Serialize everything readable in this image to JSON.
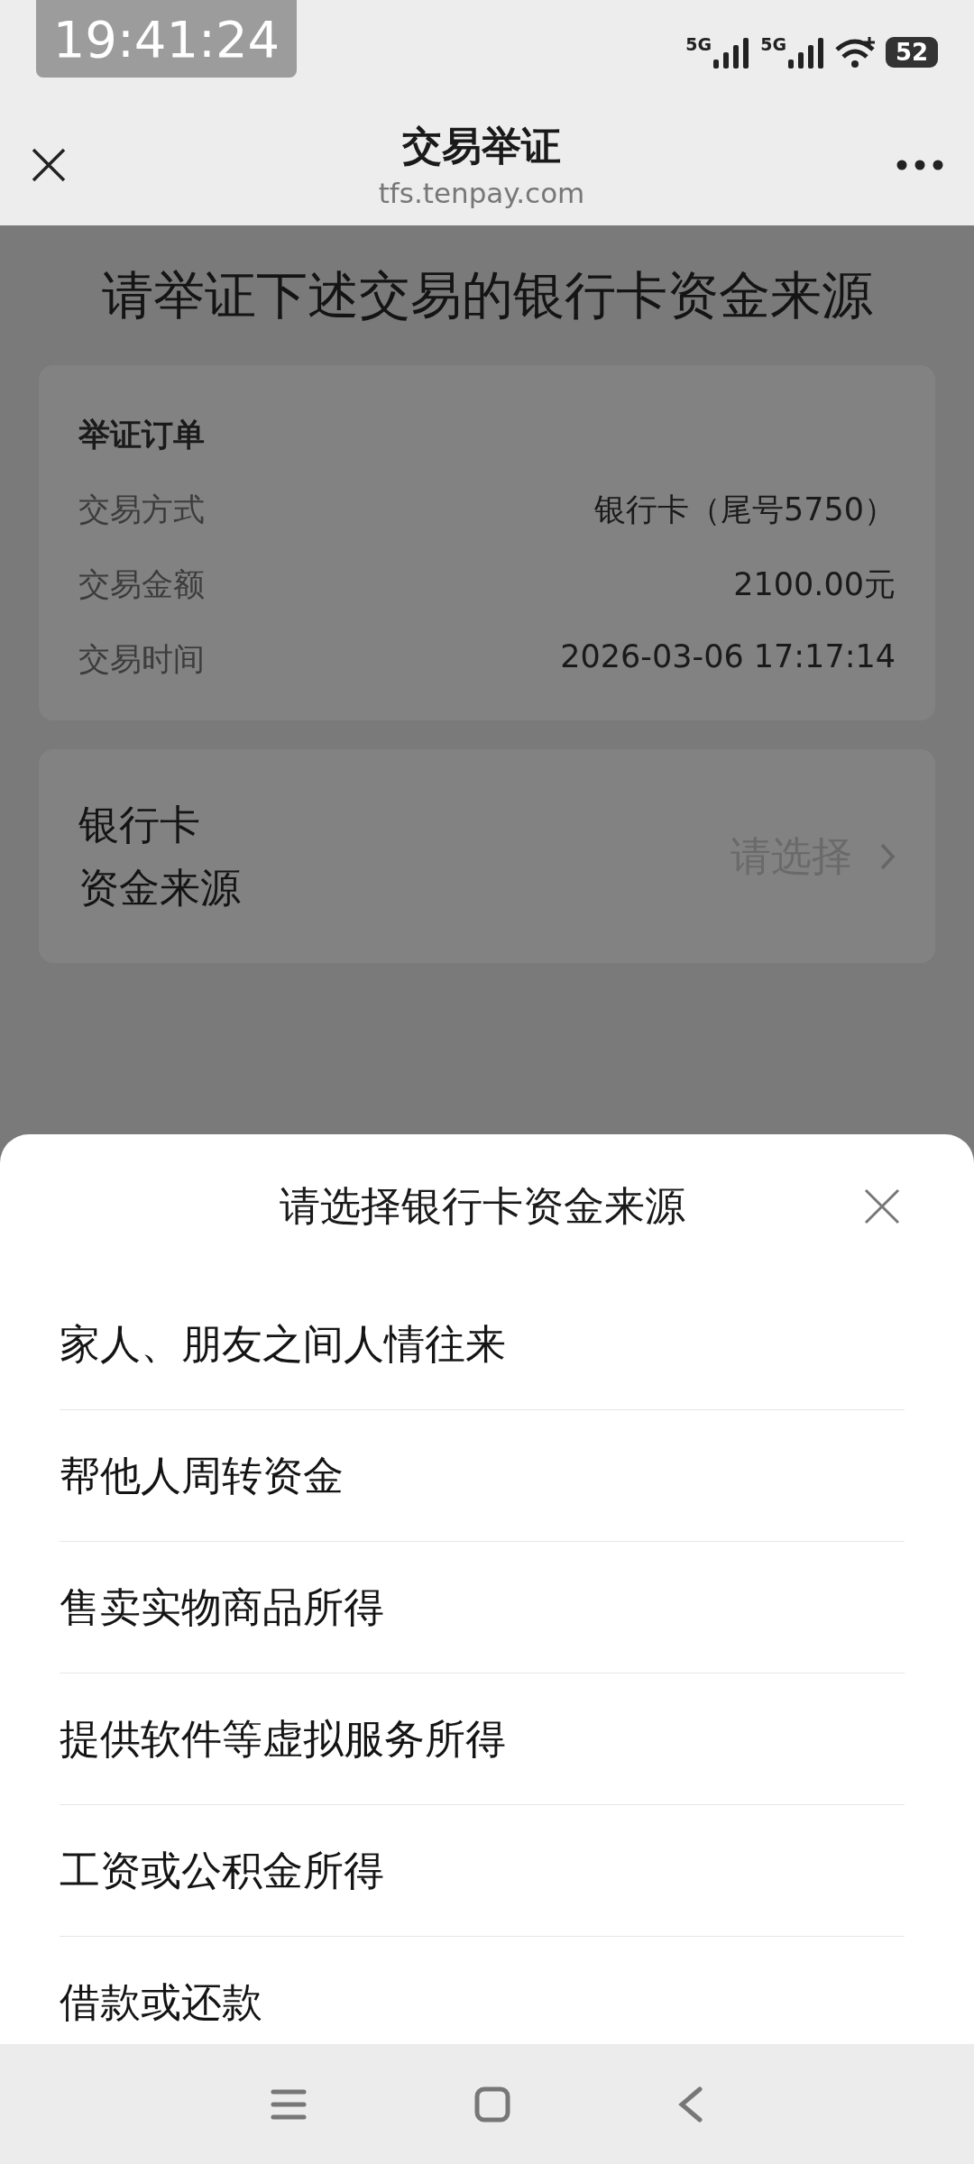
{
  "recorder_overlay": {
    "time": "19:41:24"
  },
  "status_bar": {
    "sim_1": "5G",
    "sim_2": "5G",
    "battery": "52"
  },
  "header": {
    "title": "交易举证",
    "url": "tfs.tenpay.com"
  },
  "page": {
    "heading": "请举证下述交易的银行卡资金来源",
    "order_card": {
      "title": "举证订单",
      "rows": [
        {
          "label": "交易方式",
          "value": "银行卡（尾号5750）"
        },
        {
          "label": "交易金额",
          "value": "2100.00元"
        },
        {
          "label": "交易时间",
          "value": "2026-03-06 17:17:14"
        }
      ]
    },
    "source_picker": {
      "label_lines": [
        "银行卡",
        "资金来源"
      ],
      "placeholder": "请选择"
    }
  },
  "sheet": {
    "title": "请选择银行卡资金来源",
    "options": [
      "家人、朋友之间人情往来",
      "帮他人周转资金",
      "售卖实物商品所得",
      "提供软件等虚拟服务所得",
      "工资或公积金所得",
      "借款或还款"
    ]
  }
}
